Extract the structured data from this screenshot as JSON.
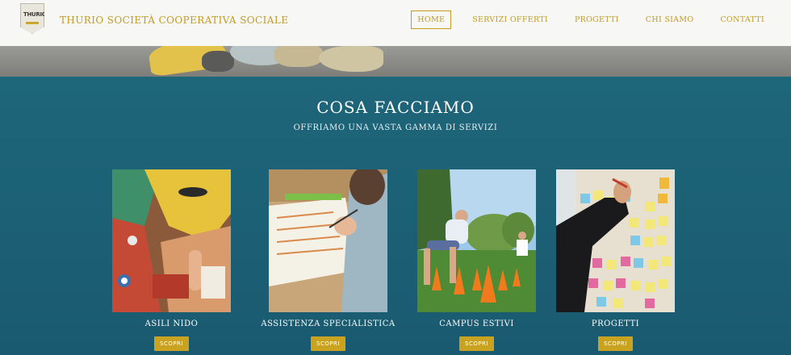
{
  "header": {
    "logo_text": "THURIO",
    "brand": "THURIO SOCIETÀ COOPERATIVA SOCIALE",
    "nav": [
      "HOME",
      "SERVIZI OFFERTI",
      "PROGETTI",
      "CHI SIAMO",
      "CONTATTI"
    ]
  },
  "section": {
    "title": "COSA FACCIAMO",
    "subtitle": "OFFRIAMO UNA VASTA GAMMA DI SERVIZI"
  },
  "cards": [
    {
      "label": "ASILI NIDO",
      "button": "SCOPRI"
    },
    {
      "label": "ASSISTENZA SPECIALISTICA",
      "button": "SCOPRI"
    },
    {
      "label": "CAMPUS ESTIVI",
      "button": "SCOPRI"
    },
    {
      "label": "PROGETTI",
      "button": "SCOPRI"
    }
  ],
  "colors": {
    "accent": "#c49a22",
    "section_bg": "#1b5f72",
    "header_bg": "#f7f7f6"
  }
}
